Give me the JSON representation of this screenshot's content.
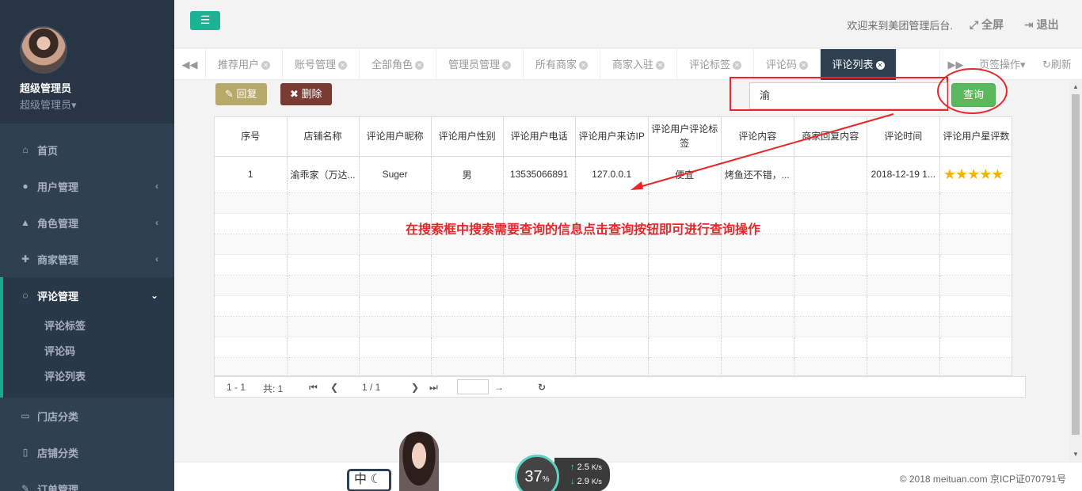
{
  "sidebar": {
    "profile": {
      "name": "超级管理员",
      "role": "超级管理员"
    },
    "items": [
      {
        "label": "首页",
        "icon": "home-icon",
        "has_children": false
      },
      {
        "label": "用户管理",
        "icon": "user-icon",
        "has_children": true
      },
      {
        "label": "角色管理",
        "icon": "flask-icon",
        "has_children": true
      },
      {
        "label": "商家管理",
        "icon": "user-plus-icon",
        "has_children": true
      },
      {
        "label": "评论管理",
        "icon": "comment-icon",
        "has_children": true,
        "expanded": true
      },
      {
        "label": "门店分类",
        "icon": "desktop-icon",
        "has_children": false
      },
      {
        "label": "店铺分类",
        "icon": "file-icon",
        "has_children": false
      },
      {
        "label": "订单管理",
        "icon": "edit-icon",
        "has_children": false
      }
    ],
    "submenu": [
      "评论标签",
      "评论码",
      "评论列表"
    ]
  },
  "topbar": {
    "welcome": "欢迎来到美团管理后台.",
    "fullscreen": "全屏",
    "logout": "退出"
  },
  "tabs": {
    "items": [
      "推荐用户",
      "账号管理",
      "全部角色",
      "管理员管理",
      "所有商家",
      "商家入驻",
      "评论标签",
      "评论码",
      "评论列表"
    ],
    "active": "评论列表",
    "page_ops": "页签操作",
    "refresh": "刷新"
  },
  "toolbar": {
    "reply": "回复",
    "delete": "删除"
  },
  "search": {
    "value": "渝",
    "button": "查询"
  },
  "table": {
    "headers": [
      "序号",
      "店铺名称",
      "评论用户昵称",
      "评论用户性别",
      "评论用户电话",
      "评论用户来访IP",
      "评论用户评论标签",
      "评论内容",
      "商家回复内容",
      "评论时间",
      "评论用户星评数"
    ],
    "rows": [
      [
        "1",
        "渝乖家（万达...",
        "Suger",
        "男",
        "13535066891",
        "127.0.0.1",
        "便宜",
        "烤鱼还不错，...",
        "",
        "2018-12-19 1...",
        ""
      ]
    ],
    "stars": 5
  },
  "pager": {
    "range": "1 - 1",
    "total": "共: 1",
    "pages": "1 / 1"
  },
  "annotation": "在搜索框中搜索需要查询的信息点击查询按钮即可进行查询操作",
  "footer": {
    "copyright": "© 2018 meituan.com 京ICP证070791号",
    "ime": "中",
    "speed_percent": "37",
    "speed_unit": "%",
    "upload": "2.5",
    "download": "2.9",
    "speed_unit_label": "K/s"
  },
  "colors": {
    "sidebar": "#2f4050",
    "accent": "#1ab394",
    "annotation": "#e8262a"
  }
}
